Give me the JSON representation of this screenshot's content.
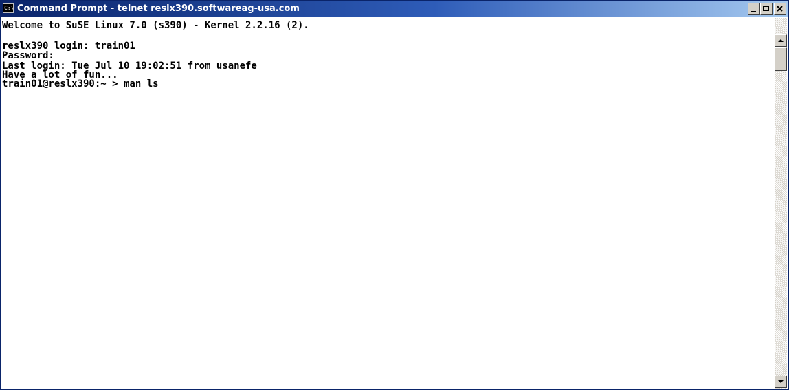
{
  "window": {
    "title": "Command Prompt - telnet reslx390.softwareag-usa.com",
    "icon": "console-icon",
    "icon_text": "C:\\"
  },
  "console": {
    "lines": [
      "Welcome to SuSE Linux 7.0 (s390) - Kernel 2.2.16 (2).",
      "",
      "reslx390 login: train01",
      "Password:",
      "Last login: Tue Jul 10 19:02:51 from usanefe",
      "Have a lot of fun...",
      "train01@reslx390:~ > man ls"
    ]
  },
  "controls": {
    "minimize": "minimize-icon",
    "maximize": "maximize-icon",
    "close": "close-icon"
  },
  "colors": {
    "titlebar_start": "#0a246a",
    "titlebar_end": "#a6caf0",
    "console_bg": "#ffffff",
    "console_text": "#000000",
    "chrome": "#d4d0c8"
  }
}
